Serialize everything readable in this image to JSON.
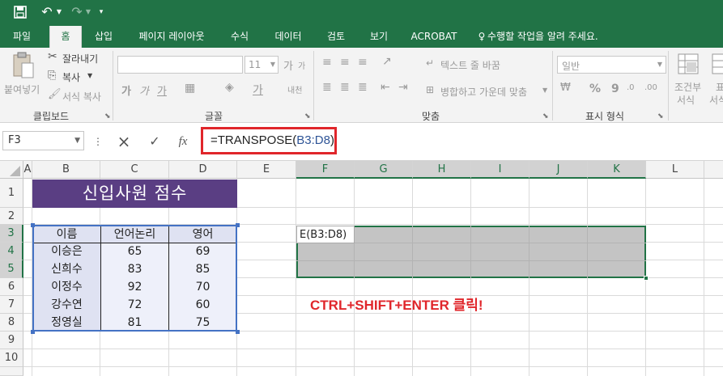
{
  "qat": {
    "save_icon": "save-icon",
    "undo_icon": "undo-icon",
    "redo_icon": "redo-icon",
    "customize_icon": "customize-icon"
  },
  "tabs": [
    "파일",
    "홈",
    "삽입",
    "페이지 레이아웃",
    "수식",
    "데이터",
    "검토",
    "보기",
    "ACROBAT",
    "수행할 작업을 알려 주세요."
  ],
  "ribbon": {
    "paste_label": "붙여넣기",
    "cut_label": "잘라내기",
    "copy_label": "복사",
    "format_painter_label": "서식 복사",
    "clipboard_group": "클립보드",
    "font_size": "11",
    "font_group": "글꼴",
    "wrap_text_label": "텍스트 줄 바꿈",
    "merge_label": "병합하고 가운데 맞춤",
    "alignment_group": "맞춤",
    "number_format": "일반",
    "number_group": "표시 형식",
    "conditional_label_1": "조건부",
    "conditional_label_2": "서식",
    "format_as_table_label_1": "표",
    "format_as_table_label_2": "서식",
    "font_style_glyphs": [
      "가",
      "가",
      "가"
    ],
    "font_grow_shrink": [
      "가",
      "가"
    ],
    "font_color_glyph": "가",
    "hangul_glyph": "내천",
    "percent_glyph": "%",
    "comma_glyph": "9"
  },
  "formula_bar": {
    "name_box": "F3",
    "cancel_icon": "×",
    "enter_icon": "✓",
    "function_icon": "fx",
    "formula_prefix": "=TRANSPOSE(",
    "formula_ref": "B3:D8",
    "formula_suffix": ")"
  },
  "columns": [
    "A",
    "B",
    "C",
    "D",
    "E",
    "F",
    "G",
    "H",
    "I",
    "J",
    "K",
    "L"
  ],
  "rows": [
    "1",
    "2",
    "3",
    "4",
    "5",
    "6",
    "7",
    "8",
    "9",
    "10"
  ],
  "sheet": {
    "title": "신입사원 점수",
    "headers": [
      "이름",
      "언어논리",
      "영어"
    ],
    "data": [
      [
        "이승은",
        "65",
        "69"
      ],
      [
        "신희수",
        "83",
        "85"
      ],
      [
        "이정수",
        "92",
        "70"
      ],
      [
        "강수연",
        "72",
        "60"
      ],
      [
        "정영실",
        "81",
        "75"
      ]
    ],
    "active_cell_text": "E(B3:D8)",
    "annotation": "CTRL+SHIFT+ENTER 클릭!"
  },
  "colors": {
    "excel_green": "#217346",
    "title_purple": "#5a3e83",
    "header_fill": "#dfe2f2",
    "data_fill": "#eef0fa",
    "highlight_red": "#e0262b",
    "selection_gray": "#c4c4c4"
  }
}
